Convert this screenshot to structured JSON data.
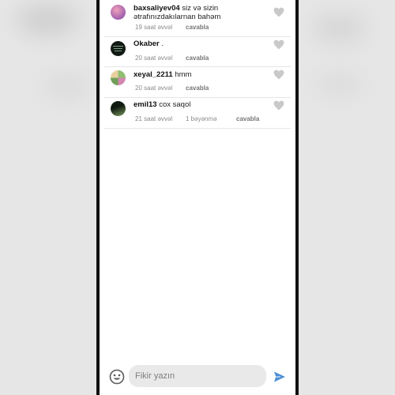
{
  "comments": [
    {
      "user": "baxsaliyev04",
      "text": "siz və sizin ətrafınızdakılarnan bahəm",
      "time": "19 saat əvvəl",
      "likes": "",
      "reply": "cavabla",
      "avatar_colors": [
        "#d86a8a",
        "#a05fb0"
      ]
    },
    {
      "user": "Okaber",
      "text": ".",
      "time": "20 saat əvvəl",
      "likes": "",
      "reply": "cavabla",
      "avatar_colors": [
        "#0f1a12",
        "#3b4a3e"
      ]
    },
    {
      "user": "xeyal_2211",
      "text": "hmm",
      "time": "20 saat əvvəl",
      "likes": "",
      "reply": "cavabla",
      "avatar_colors": [
        "#7fae6a",
        "#c77aa5"
      ]
    },
    {
      "user": "emil13",
      "text": "cox saqol",
      "time": "21 saat əvvəl",
      "likes": "1 bəyənmə",
      "reply": "cavabla",
      "avatar_colors": [
        "#1c2a1c",
        "#6f8f5a"
      ]
    }
  ],
  "composer": {
    "placeholder": "Fikir yazın",
    "icons": [
      "emoji-icon",
      "send-icon"
    ],
    "send_color": "#4d8fd6"
  },
  "colors": {
    "heart": "#c9c9c9",
    "meta_text": "#8a8a8a"
  }
}
